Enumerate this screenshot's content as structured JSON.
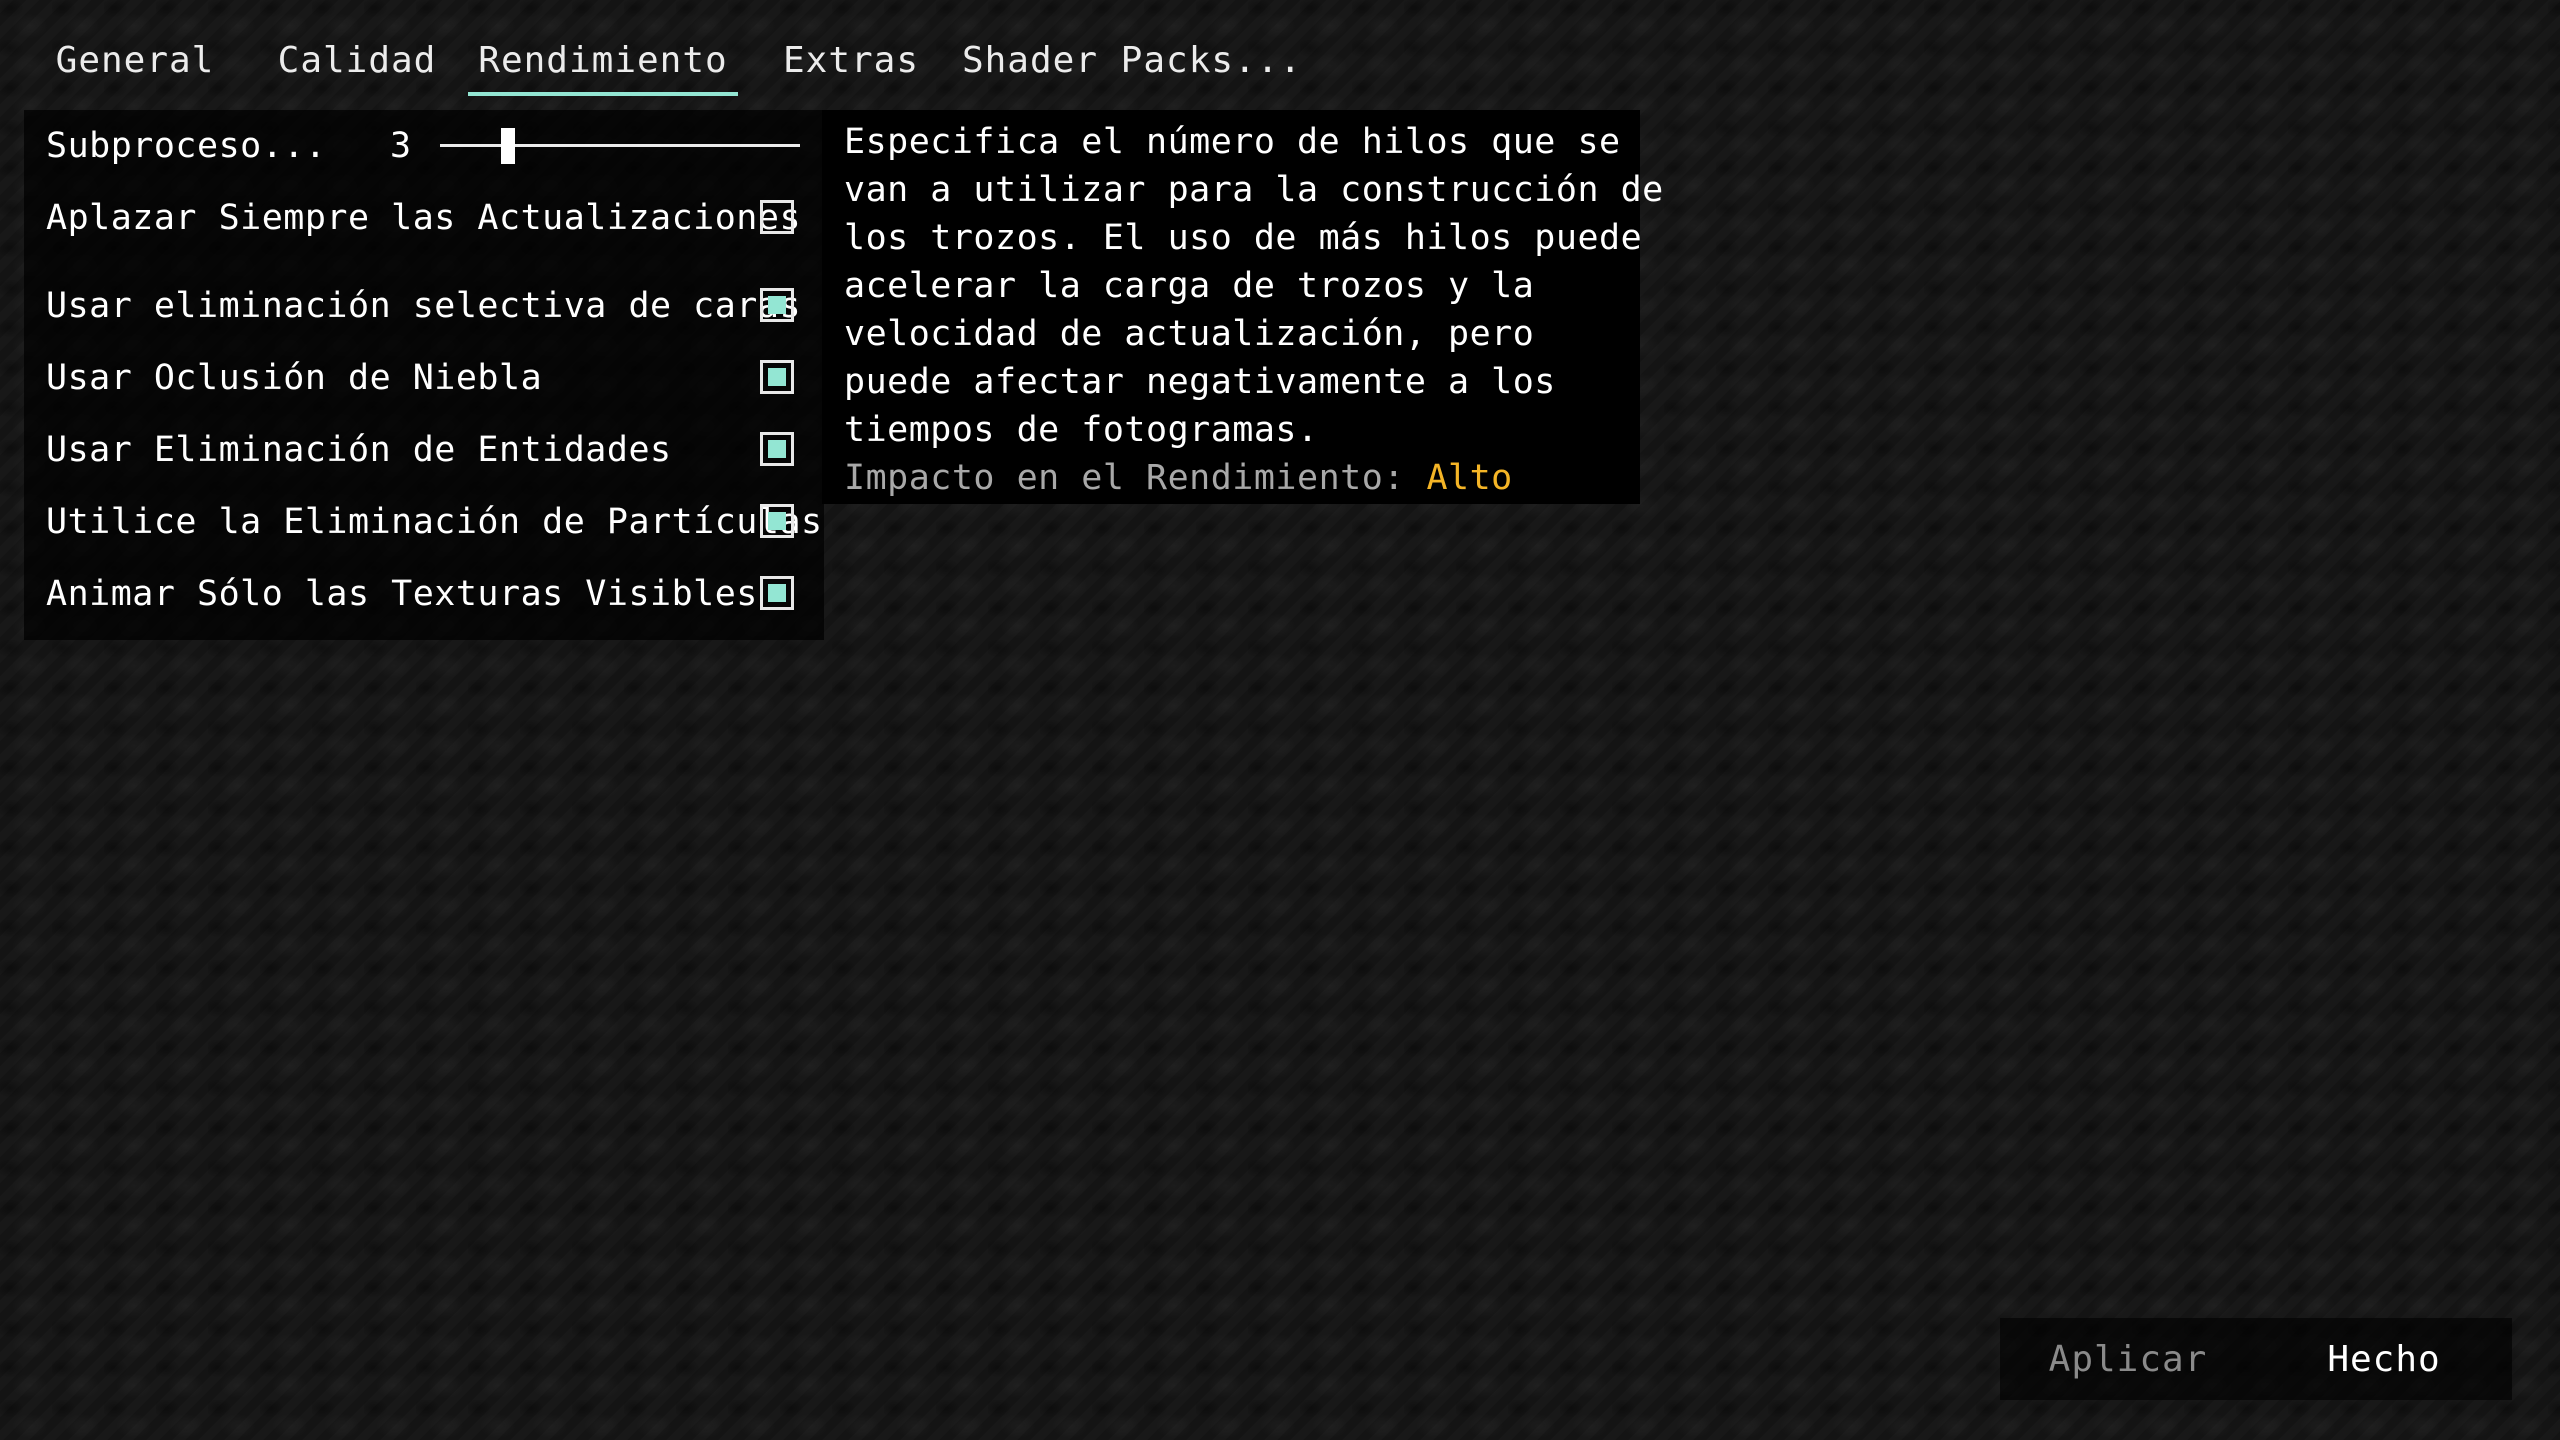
{
  "tabs": [
    {
      "label": "General",
      "active": false
    },
    {
      "label": "Calidad",
      "active": false
    },
    {
      "label": "Rendimiento",
      "active": true
    },
    {
      "label": "Extras",
      "active": false
    },
    {
      "label": "Shader Packs..."
    }
  ],
  "options": {
    "chunk_threads": {
      "label": "Subproceso...",
      "value": "3",
      "slider_fraction": 0.19
    },
    "defer_chunk_updates": {
      "label": "Aplazar Siempre las Actualizaciones de Chunks",
      "checked": false
    },
    "block_face_culling": {
      "label": "Usar eliminación selectiva de caras de bloques",
      "checked": true
    },
    "fog_occlusion": {
      "label": "Usar Oclusión de Niebla",
      "checked": true
    },
    "entity_culling": {
      "label": "Usar Eliminación de Entidades",
      "checked": true
    },
    "particle_culling": {
      "label": "Utilice la Eliminación de Partículas",
      "checked": true
    },
    "animate_visible_textures": {
      "label": "Animar Sólo las Texturas Visibles",
      "checked": true
    }
  },
  "tooltip": {
    "lines": [
      "Especifica el número de hilos que se",
      "van a utilizar para la construcción de",
      "los trozos. El uso de más hilos puede",
      "acelerar la carga de trozos y la",
      "velocidad de actualización, pero",
      "puede afectar negativamente a los",
      "tiempos de fotogramas."
    ],
    "impact_label": "Impacto en el Rendimiento: ",
    "impact_value": "Alto"
  },
  "buttons": {
    "apply": "Aplicar",
    "done": "Hecho"
  },
  "colors": {
    "accent": "#93e6d3",
    "impact_high": "#f5b526",
    "disabled_text": "#8a8a8a"
  }
}
